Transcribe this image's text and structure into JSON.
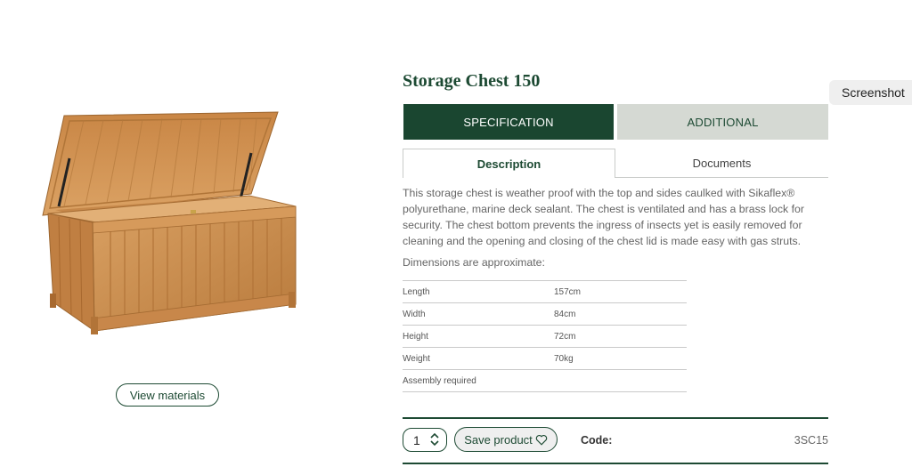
{
  "product": {
    "title": "Storage Chest 150",
    "view_materials_label": "View materials",
    "image_alt": "teak storage chest with lid open"
  },
  "tabs": [
    {
      "label": "SPECIFICATION",
      "active": true
    },
    {
      "label": "ADDITIONAL",
      "active": false
    }
  ],
  "subtabs": [
    {
      "label": "Description",
      "active": true
    },
    {
      "label": "Documents",
      "active": false
    }
  ],
  "description": "This storage chest is weather proof with the top and sides caulked with Sikaflex® polyurethane, marine deck sealant. The chest is ventilated and has a brass lock for security. The chest bottom prevents the ingress of insects yet is easily removed for cleaning and the opening and closing of the chest lid is made easy with gas struts.",
  "dimensions_note": "Dimensions are approximate:",
  "specs": [
    {
      "key": "Length",
      "value": "157cm"
    },
    {
      "key": "Width",
      "value": "84cm"
    },
    {
      "key": "Height",
      "value": "72cm"
    },
    {
      "key": "Weight",
      "value": "70kg"
    },
    {
      "key": "Assembly required",
      "value": ""
    }
  ],
  "actions": {
    "quantity": "1",
    "save_label": "Save product",
    "code_label": "Code:",
    "code_value": "3SC15"
  },
  "overlay": {
    "screenshot_label": "Screenshot"
  },
  "icons": {
    "quantity_stepper": "chevron-up-down-icon",
    "save": "heart-icon"
  },
  "colors": {
    "brand_green": "#1a4630",
    "inactive_tab": "#d5d9d3"
  }
}
